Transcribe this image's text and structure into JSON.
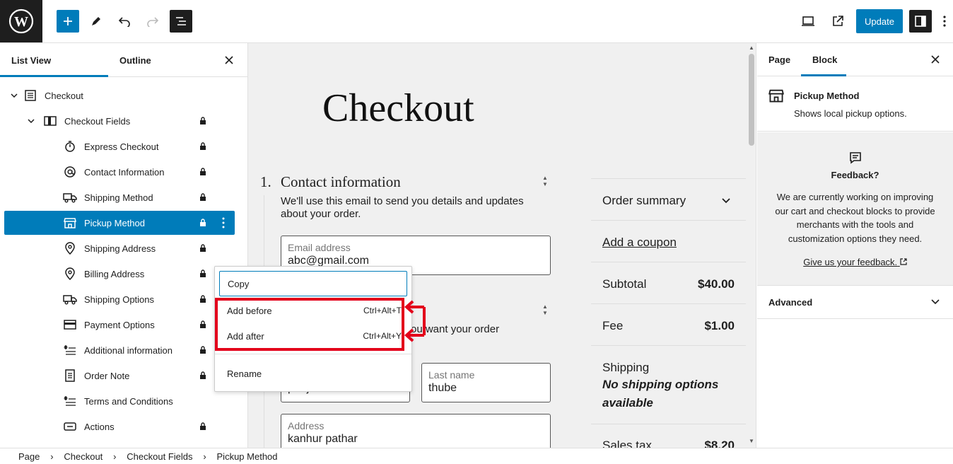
{
  "toolbar": {
    "update_label": "Update",
    "icons": [
      "wordpress-logo",
      "plus-icon",
      "pencil-icon",
      "undo-icon",
      "redo-icon",
      "list-view-icon",
      "desktop-preview-icon",
      "external-view-icon",
      "settings-sidebar-icon",
      "more-options-icon"
    ]
  },
  "list_panel": {
    "tab_list_view": "List View",
    "tab_outline": "Outline",
    "items": [
      {
        "label": "Checkout",
        "icon": "page-icon",
        "locked": false
      },
      {
        "label": "Checkout Fields",
        "icon": "columns-icon",
        "locked": true
      },
      {
        "label": "Express Checkout",
        "icon": "stopwatch-icon",
        "locked": true
      },
      {
        "label": "Contact Information",
        "icon": "at-sign-icon",
        "locked": true
      },
      {
        "label": "Shipping Method",
        "icon": "truck-icon",
        "locked": true
      },
      {
        "label": "Pickup Method",
        "icon": "store-icon",
        "locked": true,
        "selected": true
      },
      {
        "label": "Shipping Address",
        "icon": "map-pin-icon",
        "locked": true
      },
      {
        "label": "Billing Address",
        "icon": "map-pin-icon",
        "locked": true
      },
      {
        "label": "Shipping Options",
        "icon": "truck-icon",
        "locked": true
      },
      {
        "label": "Payment Options",
        "icon": "card-icon",
        "locked": true
      },
      {
        "label": "Additional information",
        "icon": "fields-icon",
        "locked": true
      },
      {
        "label": "Order Note",
        "icon": "note-icon",
        "locked": true
      },
      {
        "label": "Terms and Conditions",
        "icon": "fields-icon",
        "locked": false
      },
      {
        "label": "Actions",
        "icon": "button-icon",
        "locked": true
      }
    ]
  },
  "context_menu": {
    "copy": "Copy",
    "add_before": "Add before",
    "add_before_shortcut": "Ctrl+Alt+T",
    "add_after": "Add after",
    "add_after_shortcut": "Ctrl+Alt+Y",
    "rename": "Rename",
    "highlight_color": "#e3001b"
  },
  "canvas": {
    "title": "Checkout",
    "step_number": "1.",
    "step_title": "Contact information",
    "step_desc": "We'll use this email to send you details and updates about your order.",
    "email_label": "Email address",
    "email_value": "abc@gmail.com",
    "partial_text": "ou want your order",
    "first_name_partial": "pooja",
    "last_name_label": "Last name",
    "last_name_value": "thube",
    "address_label": "Address",
    "address_value": "kanhur pathar",
    "summary": {
      "title": "Order summary",
      "coupon": "Add a coupon",
      "subtotal_label": "Subtotal",
      "subtotal_value": "$40.00",
      "fee_label": "Fee",
      "fee_value": "$1.00",
      "shipping_label": "Shipping",
      "shipping_note": "No shipping options available",
      "tax_label": "Sales tax",
      "tax_value": "$8.20"
    }
  },
  "settings_panel": {
    "tab_page": "Page",
    "tab_block": "Block",
    "block_name": "Pickup Method",
    "block_desc": "Shows local pickup options.",
    "feedback_title": "Feedback?",
    "feedback_body": "We are currently working on improving our cart and checkout blocks to provide merchants with the tools and customization options they need.",
    "feedback_link": "Give us your feedback.",
    "advanced_label": "Advanced"
  },
  "breadcrumb": [
    "Page",
    "Checkout",
    "Checkout Fields",
    "Pickup Method"
  ],
  "colors": {
    "accent": "#007cba",
    "dark": "#1e1e1e"
  }
}
